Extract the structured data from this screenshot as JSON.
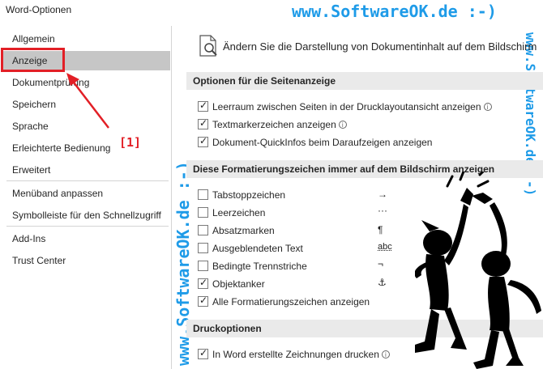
{
  "window": {
    "title": "Word-Optionen"
  },
  "watermark": {
    "top": "www.SoftwareOK.de :-)",
    "vertical": "www.SoftwareOK.de :-)"
  },
  "annotation": {
    "label": "[1]"
  },
  "sidebar": {
    "items": [
      {
        "label": "Allgemein"
      },
      {
        "label": "Anzeige"
      },
      {
        "label": "Dokumentprüfung"
      },
      {
        "label": "Speichern"
      },
      {
        "label": "Sprache"
      },
      {
        "label": "Erleichterte Bedienung"
      },
      {
        "label": "Erweitert"
      },
      {
        "label": "Menüband anpassen"
      },
      {
        "label": "Symbolleiste für den Schnellzugriff"
      },
      {
        "label": "Add-Ins"
      },
      {
        "label": "Trust Center"
      }
    ]
  },
  "main": {
    "header": "Ändern Sie die Darstellung von Dokumentinhalt auf dem Bildschirm",
    "sections": [
      {
        "title": "Optionen für die Seitenanzeige",
        "options": [
          {
            "label": "Leerraum zwischen Seiten in der Drucklayoutansicht anzeigen",
            "checked": true,
            "info": true
          },
          {
            "label": "Textmarkerzeichen anzeigen",
            "checked": true,
            "info": true
          },
          {
            "label": "Dokument-QuickInfos beim Daraufzeigen anzeigen",
            "checked": true,
            "info": false
          }
        ]
      },
      {
        "title": "Diese Formatierungszeichen immer auf dem Bildschirm anzeigen",
        "options": [
          {
            "label": "Tabstoppzeichen",
            "checked": false,
            "symbol": "→"
          },
          {
            "label": "Leerzeichen",
            "checked": false,
            "symbol": "···"
          },
          {
            "label": "Absatzmarken",
            "checked": false,
            "symbol": "¶"
          },
          {
            "label": "Ausgeblendeten Text",
            "checked": false,
            "symbol": "abc"
          },
          {
            "label": "Bedingte Trennstriche",
            "checked": false,
            "symbol": "¬"
          },
          {
            "label": "Objektanker",
            "checked": true,
            "symbol": "⚓"
          },
          {
            "label": "Alle Formatierungszeichen anzeigen",
            "checked": true,
            "symbol": ""
          }
        ]
      },
      {
        "title": "Druckoptionen",
        "options": [
          {
            "label": "In Word erstellte Zeichnungen drucken",
            "checked": true,
            "info": true
          }
        ]
      }
    ]
  },
  "colors": {
    "accent_red": "#e21f26",
    "watermark_blue": "#1e9be8",
    "selected_bg": "#c6c6c6",
    "section_bg": "#eaeaea"
  },
  "icons": [
    "document-search-icon",
    "info-icon",
    "checkbox-icon",
    "stick-figures-illustration"
  ]
}
